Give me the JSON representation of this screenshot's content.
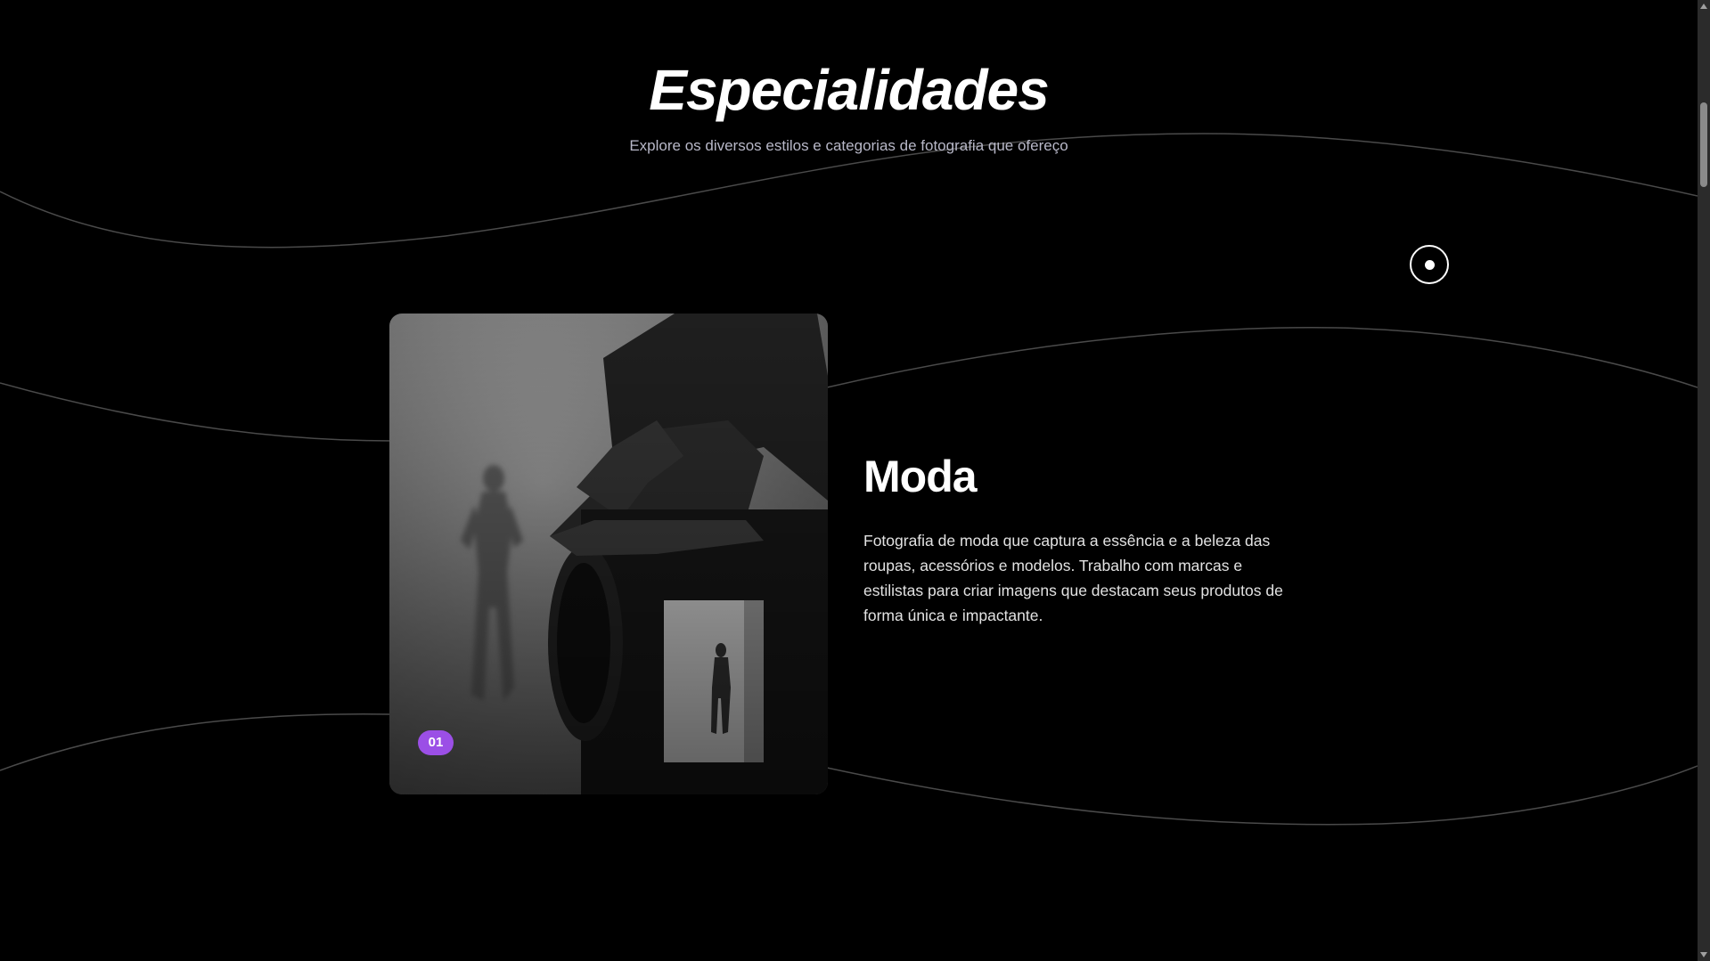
{
  "header": {
    "title": "Especialidades",
    "subtitle": "Explore os diversos estilos e categorias de fotografia que ofereço"
  },
  "specialty": {
    "badge": "01",
    "title": "Moda",
    "description": "Fotografia de moda que captura a essência e a beleza das roupas, acessórios e modelos. Trabalho com marcas e estilistas para criar imagens que destacam seus produtos de forma única e impactante.",
    "image_alt": "Fotógrafo segurando câmera fotografando modelo em estúdio"
  },
  "colors": {
    "background": "#000000",
    "badge": "#9b4fe6",
    "wave_lines": "#4a4a4a"
  },
  "icons": {
    "cursor": "circle-cursor-icon"
  }
}
